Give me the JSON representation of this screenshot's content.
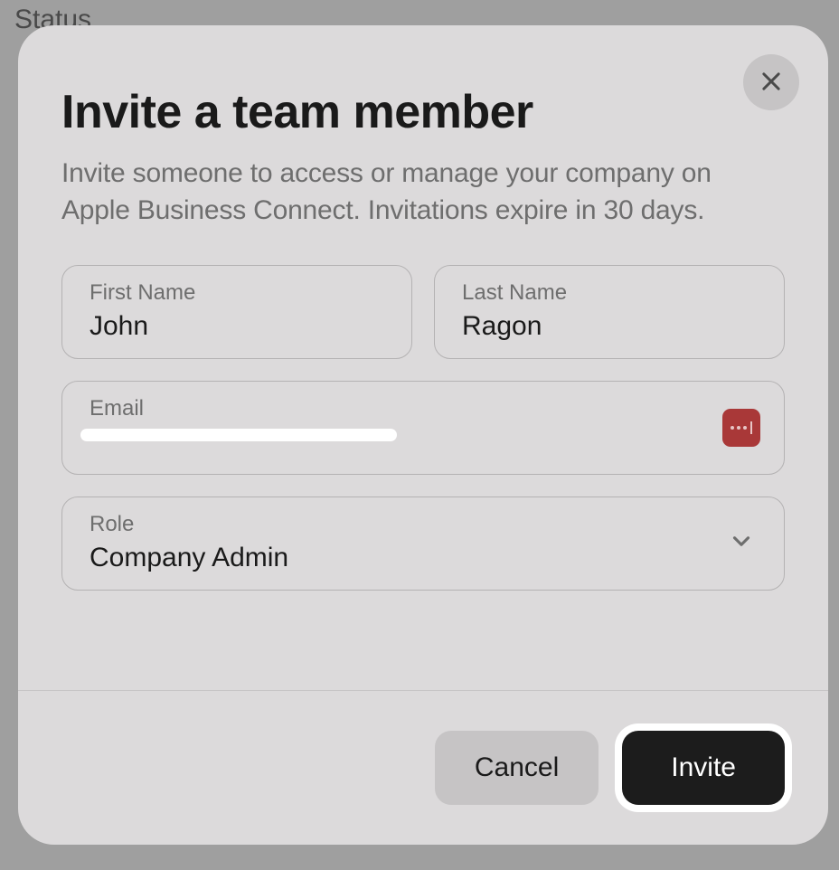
{
  "backdrop": {
    "status_label": "Status"
  },
  "modal": {
    "title": "Invite a team member",
    "subtitle": "Invite someone to access or manage your company on Apple Business Connect. Invitations expire in 30 days.",
    "fields": {
      "first_name": {
        "label": "First Name",
        "value": "John"
      },
      "last_name": {
        "label": "Last Name",
        "value": "Ragon"
      },
      "email": {
        "label": "Email",
        "value": ""
      },
      "role": {
        "label": "Role",
        "value": "Company Admin"
      }
    },
    "buttons": {
      "cancel": "Cancel",
      "invite": "Invite"
    }
  }
}
